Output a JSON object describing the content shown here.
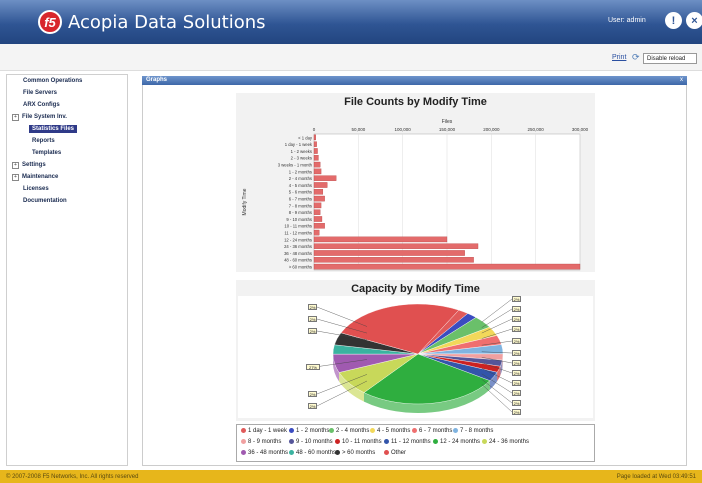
{
  "header": {
    "logo_text": "f5",
    "app_title": "Acopia Data Solutions",
    "user_label": "User: admin",
    "help_icon": "info-icon",
    "close_icon": "close-icon"
  },
  "toolbar": {
    "print_label": "Print",
    "reload_select_value": "Disable reload"
  },
  "sidebar": {
    "items": [
      {
        "label": "Common Operations"
      },
      {
        "label": "File Servers"
      },
      {
        "label": "ARX Configs"
      },
      {
        "label": "File System Inv."
      },
      {
        "label": "Statistics Files"
      },
      {
        "label": "Reports"
      },
      {
        "label": "Templates"
      },
      {
        "label": "Settings"
      },
      {
        "label": "Maintenance"
      },
      {
        "label": "Licenses"
      },
      {
        "label": "Documentation"
      }
    ],
    "expander": "+"
  },
  "panel": {
    "title": "Graphs",
    "close_glyph": "x"
  },
  "chart_data": [
    {
      "type": "bar",
      "title": "File Counts by Modify Time",
      "xlabel": "Files",
      "ylabel": "Modify Time",
      "orientation": "horizontal",
      "xlim": [
        0,
        300000
      ],
      "ticks": [
        "0",
        "50,000",
        "100,000",
        "150,000",
        "200,000",
        "250,000",
        "300,000"
      ],
      "categories": [
        "< 1 day",
        "1 day - 1 week",
        "1 - 2 weeks",
        "2 - 3 weeks",
        "3 weeks - 1 month",
        "1 - 2 months",
        "2 - 4 months",
        "4 - 5 months",
        "5 - 6 months",
        "6 - 7 months",
        "7 - 8 months",
        "8 - 9 months",
        "9 - 10 months",
        "10 - 11 months",
        "11 - 12 months",
        "12 - 24 months",
        "24 - 36 months",
        "36 - 48 months",
        "48 - 60 months",
        "> 60 months"
      ],
      "values": [
        2000,
        3000,
        4000,
        5000,
        7000,
        8000,
        25000,
        15000,
        10000,
        12000,
        8000,
        7000,
        9000,
        12000,
        6000,
        150000,
        185000,
        170000,
        180000,
        310000
      ],
      "bar_color": "#e36b6b"
    },
    {
      "type": "pie",
      "title": "Capacity by Modify Time",
      "categories": [
        "1 day - 1 week",
        "1 - 2 months",
        "2 - 4 months",
        "4 - 5 months",
        "6 - 7 months",
        "7 - 8 months",
        "8 - 9 months",
        "9 - 10 months",
        "10 - 11 months",
        "11 - 12 months",
        "12 - 24 months",
        "24 - 36 months",
        "36 - 48 months",
        "48 - 60 months",
        "> 60 months",
        "Other"
      ],
      "values": [
        2,
        2,
        4,
        3,
        3,
        3,
        2,
        2,
        2,
        3,
        27,
        8,
        6,
        3,
        4,
        26
      ],
      "label_values": [
        "2%",
        "2%",
        "2%",
        "27%",
        "2%",
        "2%",
        "2%",
        "2%",
        "2%",
        "2%",
        "2%",
        "2%",
        "2%",
        "2%",
        "2%",
        "2%",
        "2%",
        "2%"
      ],
      "colors": [
        "#e05a5a",
        "#3b4cc0",
        "#6ac06a",
        "#f2d85a",
        "#ef6f6f",
        "#7fb3e0",
        "#f0a0a0",
        "#555599",
        "#cc2222",
        "#3355aa",
        "#2fae3f",
        "#c8d85a",
        "#a05ab0",
        "#3bb3a0",
        "#333333",
        "#e05050"
      ]
    }
  ],
  "footer": {
    "copyright": "© 2007-2008 F5 Networks, Inc. All rights reserved",
    "loaded_text": "Page loaded at Wed 03:49:51"
  }
}
